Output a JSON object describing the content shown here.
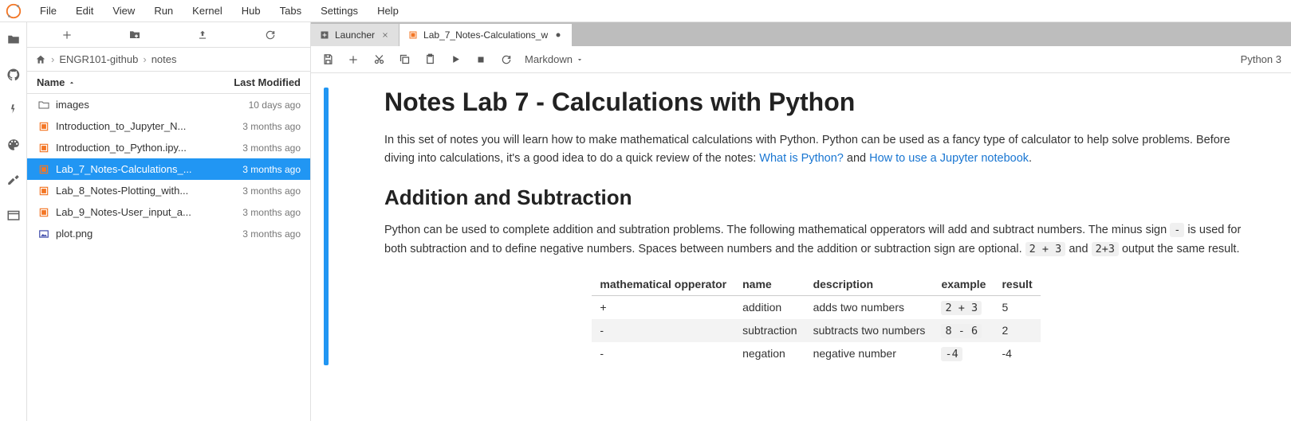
{
  "menu": [
    "File",
    "Edit",
    "View",
    "Run",
    "Kernel",
    "Hub",
    "Tabs",
    "Settings",
    "Help"
  ],
  "breadcrumb": {
    "items": [
      "ENGR101-github",
      "notes"
    ]
  },
  "fileHeader": {
    "name": "Name",
    "modified": "Last Modified"
  },
  "files": [
    {
      "name": "images",
      "modified": "10 days ago",
      "type": "folder",
      "selected": false
    },
    {
      "name": "Introduction_to_Jupyter_N...",
      "modified": "3 months ago",
      "type": "notebook",
      "selected": false
    },
    {
      "name": "Introduction_to_Python.ipy...",
      "modified": "3 months ago",
      "type": "notebook",
      "selected": false
    },
    {
      "name": "Lab_7_Notes-Calculations_...",
      "modified": "3 months ago",
      "type": "notebook",
      "selected": true
    },
    {
      "name": "Lab_8_Notes-Plotting_with...",
      "modified": "3 months ago",
      "type": "notebook",
      "selected": false
    },
    {
      "name": "Lab_9_Notes-User_input_a...",
      "modified": "3 months ago",
      "type": "notebook",
      "selected": false
    },
    {
      "name": "plot.png",
      "modified": "3 months ago",
      "type": "image",
      "selected": false
    }
  ],
  "tabs": [
    {
      "label": "Launcher",
      "type": "launcher",
      "active": false,
      "dirty": false
    },
    {
      "label": "Lab_7_Notes-Calculations_w",
      "type": "notebook",
      "active": true,
      "dirty": true
    }
  ],
  "nbToolbar": {
    "cellType": "Markdown",
    "kernel": "Python 3"
  },
  "notebook": {
    "h1": "Notes Lab 7 - Calculations with Python",
    "p1a": "In this set of notes you will learn how to make mathematical calculations with Python. Python can be used as a fancy type of calculator to help solve problems. Before diving into calculations, it's a good idea to do a quick review of the notes: ",
    "link1": "What is Python?",
    "p1b": " and ",
    "link2": "How to use a Jupyter notebook",
    "p1c": ".",
    "h2": "Addition and Subtraction",
    "p2a": "Python can be used to complete addition and subtration problems. The following mathematical opperators will add and subtract numbers. The minus sign ",
    "code1": "-",
    "p2b": " is used for both subtraction and to define negative numbers. Spaces between numbers and the addition or subtraction sign are optional. ",
    "code2": "2 + 3",
    "p2c": " and ",
    "code3": "2+3",
    "p2d": " output the same result.",
    "table": {
      "headers": [
        "mathematical opperator",
        "name",
        "description",
        "example",
        "result"
      ],
      "rows": [
        [
          "+",
          "addition",
          "adds two numbers",
          "2 + 3",
          "5"
        ],
        [
          "-",
          "subtraction",
          "subtracts two numbers",
          "8 - 6",
          "2"
        ],
        [
          "-",
          "negation",
          "negative number",
          "-4",
          "-4"
        ]
      ]
    }
  }
}
